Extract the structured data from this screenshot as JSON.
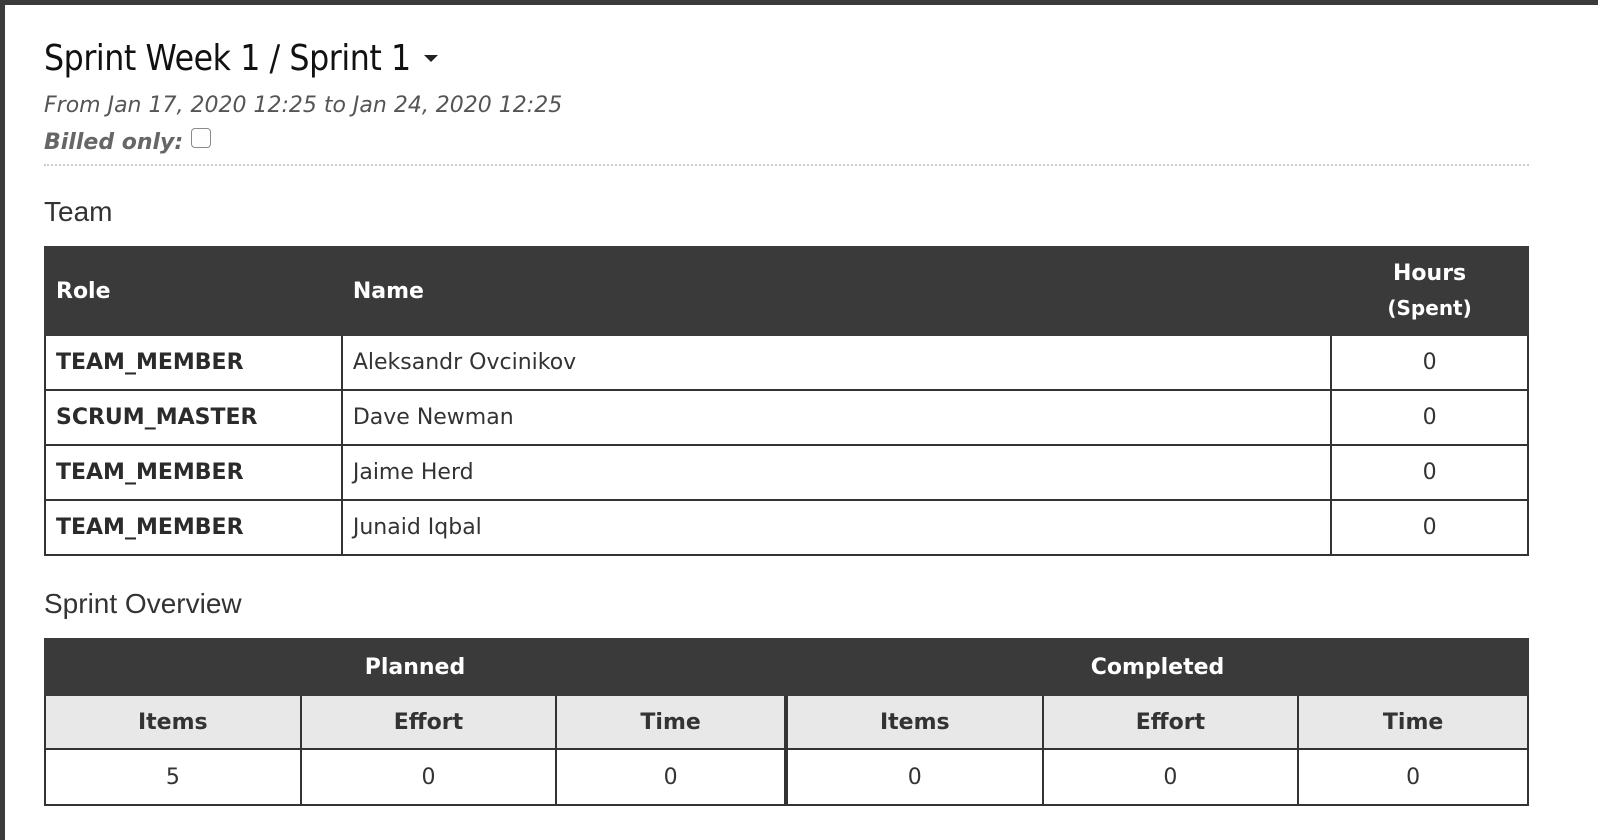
{
  "header": {
    "title": "Sprint Week 1 / Sprint 1",
    "date_range": "From Jan 17, 2020 12:25 to Jan 24, 2020 12:25",
    "billed_only_label": "Billed only:"
  },
  "team": {
    "section_title": "Team",
    "columns": {
      "role": "Role",
      "name": "Name",
      "hours": "Hours",
      "hours_sub": "(Spent)"
    },
    "rows": [
      {
        "role": "TEAM_MEMBER",
        "name": "Aleksandr Ovcinikov",
        "hours": "0"
      },
      {
        "role": "SCRUM_MASTER",
        "name": "Dave Newman",
        "hours": "0"
      },
      {
        "role": "TEAM_MEMBER",
        "name": "Jaime Herd",
        "hours": "0"
      },
      {
        "role": "TEAM_MEMBER",
        "name": "Junaid Iqbal",
        "hours": "0"
      }
    ]
  },
  "overview": {
    "section_title": "Sprint Overview",
    "groups": {
      "planned": "Planned",
      "completed": "Completed"
    },
    "sub_columns": [
      "Items",
      "Effort",
      "Time",
      "Items",
      "Effort",
      "Time"
    ],
    "values": [
      "5",
      "0",
      "0",
      "0",
      "0",
      "0"
    ]
  }
}
